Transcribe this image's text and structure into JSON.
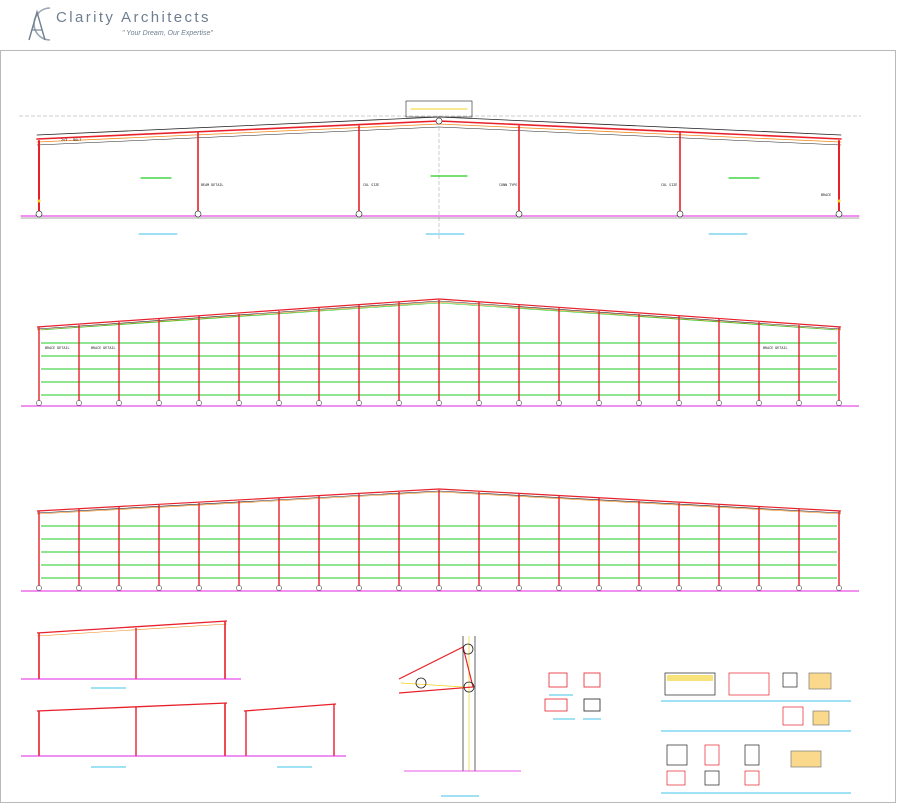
{
  "brand": {
    "name": "Clarity Architects",
    "tagline": "\" Your Dream, Our Expertise\"",
    "logo": "architect-compass-logo",
    "text_color": "#6f7f91"
  },
  "colors": {
    "frame": "#e8202a",
    "purlin": "#f08a1e",
    "girt": "#22cc22",
    "floor_line": "#e020e0",
    "title": "#00b0e0",
    "grid_dash": "#9a9a9a",
    "linework": "#222222"
  }
}
